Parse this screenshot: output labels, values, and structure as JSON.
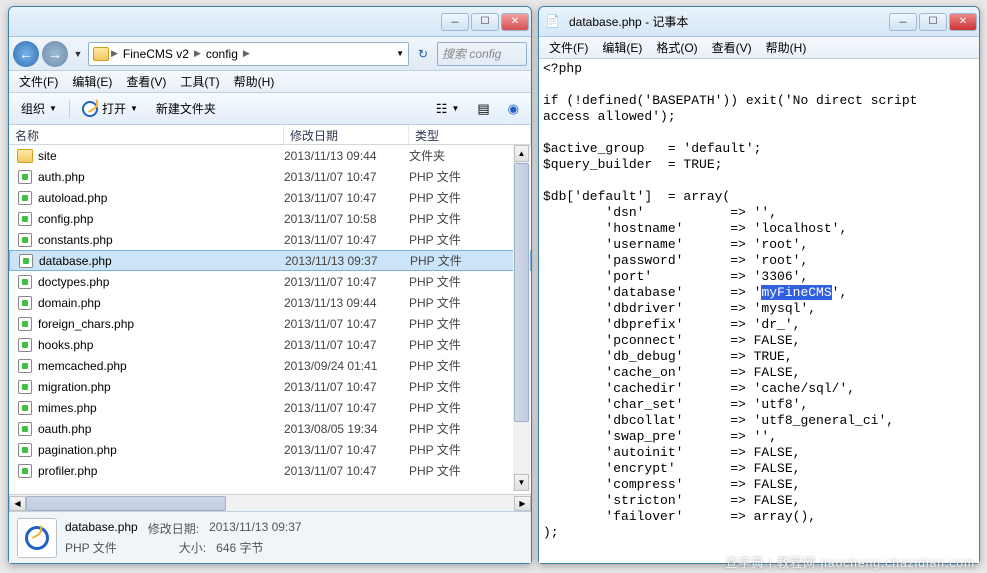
{
  "explorer": {
    "breadcrumb": [
      "FineCMS v2",
      "config"
    ],
    "search_placeholder": "搜索 config",
    "menu": [
      "文件(F)",
      "编辑(E)",
      "查看(V)",
      "工具(T)",
      "帮助(H)"
    ],
    "toolbar": {
      "organize": "组织",
      "open": "打开",
      "newfolder": "新建文件夹"
    },
    "columns": {
      "name": "名称",
      "date": "修改日期",
      "type": "类型"
    },
    "rows": [
      {
        "icon": "folder",
        "name": "site",
        "date": "2013/11/13 09:44",
        "type": "文件夹"
      },
      {
        "icon": "php",
        "name": "auth.php",
        "date": "2013/11/07 10:47",
        "type": "PHP 文件"
      },
      {
        "icon": "php",
        "name": "autoload.php",
        "date": "2013/11/07 10:47",
        "type": "PHP 文件"
      },
      {
        "icon": "php",
        "name": "config.php",
        "date": "2013/11/07 10:58",
        "type": "PHP 文件"
      },
      {
        "icon": "php",
        "name": "constants.php",
        "date": "2013/11/07 10:47",
        "type": "PHP 文件"
      },
      {
        "icon": "php",
        "name": "database.php",
        "date": "2013/11/13 09:37",
        "type": "PHP 文件",
        "selected": true
      },
      {
        "icon": "php",
        "name": "doctypes.php",
        "date": "2013/11/07 10:47",
        "type": "PHP 文件"
      },
      {
        "icon": "php",
        "name": "domain.php",
        "date": "2013/11/13 09:44",
        "type": "PHP 文件"
      },
      {
        "icon": "php",
        "name": "foreign_chars.php",
        "date": "2013/11/07 10:47",
        "type": "PHP 文件"
      },
      {
        "icon": "php",
        "name": "hooks.php",
        "date": "2013/11/07 10:47",
        "type": "PHP 文件"
      },
      {
        "icon": "php",
        "name": "memcached.php",
        "date": "2013/09/24 01:41",
        "type": "PHP 文件"
      },
      {
        "icon": "php",
        "name": "migration.php",
        "date": "2013/11/07 10:47",
        "type": "PHP 文件"
      },
      {
        "icon": "php",
        "name": "mimes.php",
        "date": "2013/11/07 10:47",
        "type": "PHP 文件"
      },
      {
        "icon": "php",
        "name": "oauth.php",
        "date": "2013/08/05 19:34",
        "type": "PHP 文件"
      },
      {
        "icon": "php",
        "name": "pagination.php",
        "date": "2013/11/07 10:47",
        "type": "PHP 文件"
      },
      {
        "icon": "php",
        "name": "profiler.php",
        "date": "2013/11/07 10:47",
        "type": "PHP 文件"
      }
    ],
    "status": {
      "filename": "database.php",
      "date_label": "修改日期:",
      "date_value": "2013/11/13 09:37",
      "type_line": "PHP 文件",
      "size_label": "大小:",
      "size_value": "646 字节"
    }
  },
  "notepad": {
    "title": "database.php - 记事本",
    "menu": [
      "文件(F)",
      "编辑(E)",
      "格式(O)",
      "查看(V)",
      "帮助(H)"
    ],
    "code_pre": "<?php\n\nif (!defined('BASEPATH')) exit('No direct script\naccess allowed');\n\n$active_group   = 'default';\n$query_builder  = TRUE;\n\n$db['default']  = array(\n        'dsn'           => '',\n        'hostname'      => 'localhost',\n        'username'      => 'root',\n        'password'      => 'root',\n        'port'          => '3306',\n        'database'      => '",
    "highlight": "myFineCMS",
    "code_post": "',\n        'dbdriver'      => 'mysql',\n        'dbprefix'      => 'dr_',\n        'pconnect'      => FALSE,\n        'db_debug'      => TRUE,\n        'cache_on'      => FALSE,\n        'cachedir'      => 'cache/sql/',\n        'char_set'      => 'utf8',\n        'dbcollat'      => 'utf8_general_ci',\n        'swap_pre'      => '',\n        'autoinit'      => FALSE,\n        'encrypt'       => FALSE,\n        'compress'      => FALSE,\n        'stricton'      => FALSE,\n        'failover'      => array(),\n);"
  },
  "watermark": "查字典 | 教程网\njiaocheng.chazidian.com"
}
